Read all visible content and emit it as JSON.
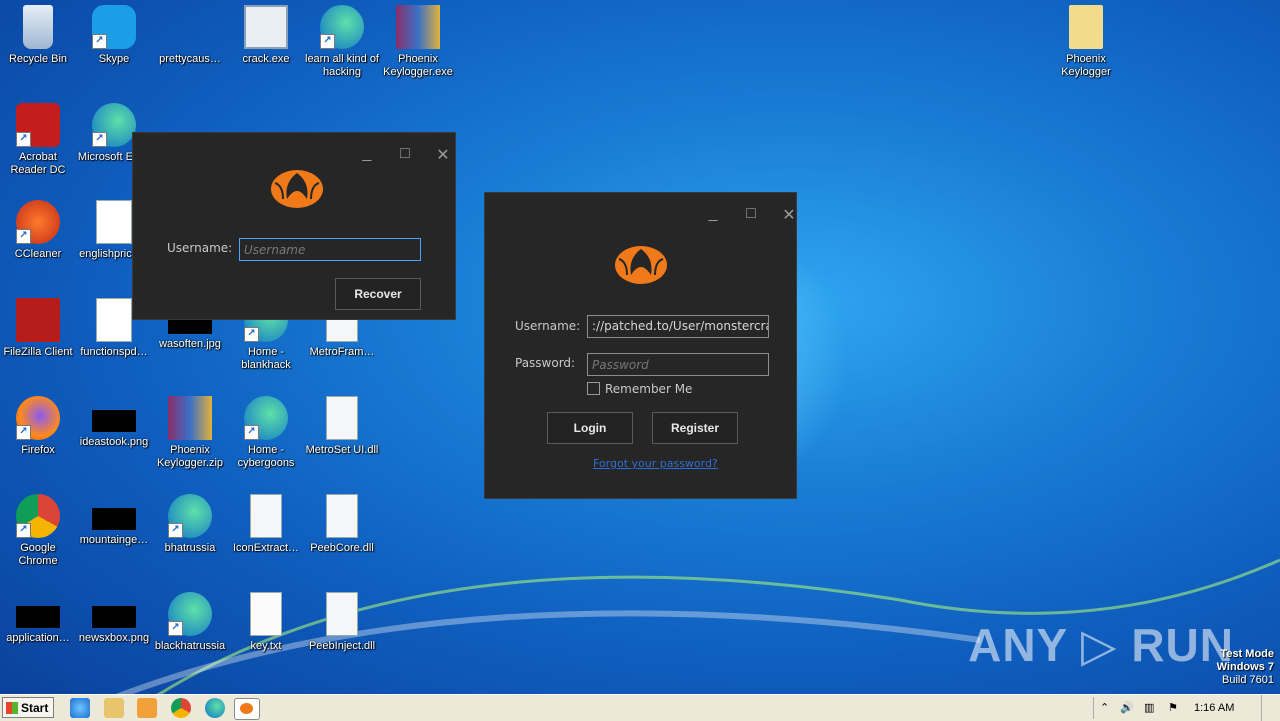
{
  "desktop": {
    "icons": [
      {
        "label": "Recycle Bin",
        "icon": "recycle-bin-icon"
      },
      {
        "label": "Skype",
        "icon": "skype-icon"
      },
      {
        "label": "prettycaus…",
        "icon": "file-icon"
      },
      {
        "label": "crack.exe",
        "icon": "exe-window-icon"
      },
      {
        "label": "learn all kind of hacking",
        "icon": "edge-icon"
      },
      {
        "label": "Phoenix Keylogger.exe",
        "icon": "winrar-icon"
      },
      {
        "label": "Phoenix Keylogger",
        "icon": "folder-icon"
      },
      {
        "label": "Acrobat Reader DC",
        "icon": "acrobat-icon"
      },
      {
        "label": "Microsoft Ed…",
        "icon": "edge-icon"
      },
      {
        "label": "CCleaner",
        "icon": "ccleaner-icon"
      },
      {
        "label": "englishprice…",
        "icon": "word-doc-icon"
      },
      {
        "label": "FileZilla Client",
        "icon": "filezilla-icon"
      },
      {
        "label": "functionspd…",
        "icon": "word-doc-icon"
      },
      {
        "label": "wasoften.jpg",
        "icon": "image-icon"
      },
      {
        "label": "Home - blankhack",
        "icon": "edge-icon"
      },
      {
        "label": "MetroFram…",
        "icon": "dll-icon"
      },
      {
        "label": "Firefox",
        "icon": "firefox-icon"
      },
      {
        "label": "ideastook.png",
        "icon": "image-icon"
      },
      {
        "label": "Phoenix Keylogger.zip",
        "icon": "winrar-icon"
      },
      {
        "label": "Home - cybergoons",
        "icon": "edge-icon"
      },
      {
        "label": "MetroSet UI.dll",
        "icon": "dll-icon"
      },
      {
        "label": "Google Chrome",
        "icon": "chrome-icon"
      },
      {
        "label": "mountainge…",
        "icon": "image-icon"
      },
      {
        "label": "bhatrussia",
        "icon": "edge-icon"
      },
      {
        "label": "IconExtract…",
        "icon": "dll-icon"
      },
      {
        "label": "PeebCore.dll",
        "icon": "dll-icon"
      },
      {
        "label": "application…",
        "icon": "image-icon"
      },
      {
        "label": "newsxbox.png",
        "icon": "image-icon"
      },
      {
        "label": "blackhatrussia",
        "icon": "edge-icon"
      },
      {
        "label": "key.txt",
        "icon": "text-file-icon"
      },
      {
        "label": "PeebInject.dll",
        "icon": "dll-icon"
      }
    ]
  },
  "recover_dialog": {
    "controls": {
      "minimize": "_",
      "maximize": "□",
      "close": "✕"
    },
    "username_label": "Username:",
    "username_placeholder": "Username",
    "recover_button": "Recover"
  },
  "login_dialog": {
    "controls": {
      "minimize": "_",
      "maximize": "□",
      "close": "✕"
    },
    "username_label": "Username:",
    "username_value": "://patched.to/User/monstercrack",
    "password_label": "Password:",
    "password_placeholder": "Password",
    "remember_label": "Remember Me",
    "login_button": "Login",
    "register_button": "Register",
    "forgot_link": "Forgot your password?"
  },
  "taskbar": {
    "start_label": "Start",
    "clock": "1:16 AM"
  },
  "watermark": {
    "text": "ANY ▷ RUN"
  },
  "system_info": {
    "line1": "Test Mode",
    "line2": "Windows 7",
    "line3": "Build 7601"
  },
  "colors": {
    "dialog_bg": "#262626",
    "phoenix_orange": "#f07a1a",
    "link_blue": "#2d6fd6",
    "focus_blue": "#4aa5ff"
  }
}
